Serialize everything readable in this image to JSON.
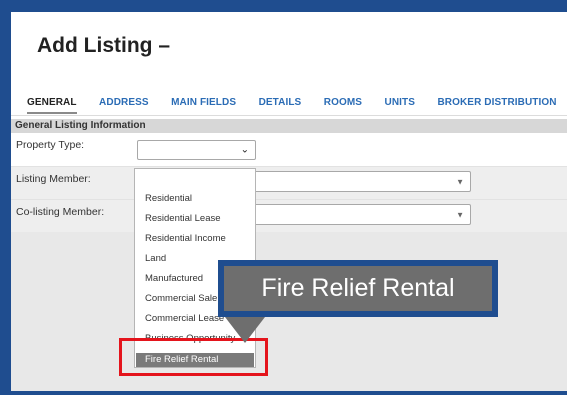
{
  "page": {
    "title": "Add Listing –"
  },
  "tabs": [
    "GENERAL",
    "ADDRESS",
    "MAIN FIELDS",
    "DETAILS",
    "ROOMS",
    "UNITS",
    "BROKER DISTRIBUTION"
  ],
  "section": {
    "title": "General Listing Information"
  },
  "fields": {
    "property_type": {
      "label": "Property Type:",
      "value": ""
    },
    "listing_member": {
      "label": "Listing Member:",
      "value": ""
    },
    "co_listing_member": {
      "label": "Co-listing Member:",
      "value": ""
    }
  },
  "dropdown": {
    "options": [
      "Residential",
      "Residential Lease",
      "Residential Income",
      "Land",
      "Manufactured",
      "Commercial Sale",
      "Commercial Lease",
      "Business Opportunity"
    ],
    "highlighted": "Fire Relief Rental"
  },
  "callout": {
    "text": "Fire Relief Rental"
  },
  "colors": {
    "frame": "#1f4d8f",
    "tab_link": "#2b6cb5",
    "highlight": "#e4141c",
    "callout_bg": "#6e6e6e"
  }
}
